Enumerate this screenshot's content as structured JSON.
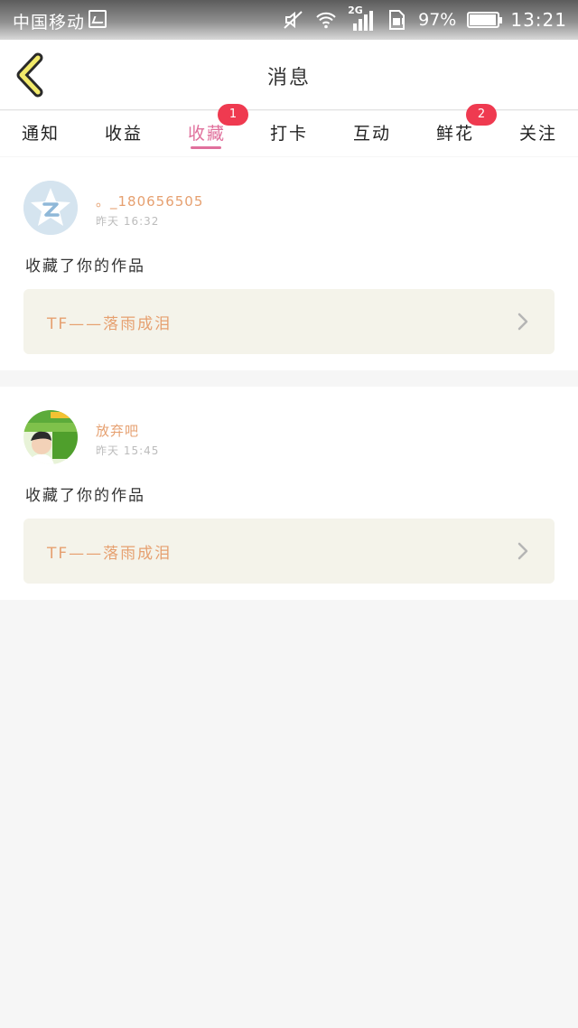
{
  "status_bar": {
    "carrier": "中国移动",
    "network": "2G",
    "battery_percent": "97%",
    "battery_level": 0.97,
    "time": "13:21"
  },
  "header": {
    "title": "消息"
  },
  "tabs": [
    {
      "label": "通知",
      "badge": ""
    },
    {
      "label": "收益",
      "badge": ""
    },
    {
      "label": "收藏",
      "badge": "1"
    },
    {
      "label": "打卡",
      "badge": ""
    },
    {
      "label": "互动",
      "badge": ""
    },
    {
      "label": "鲜花",
      "badge": "2"
    },
    {
      "label": "关注",
      "badge": ""
    }
  ],
  "active_tab": "收藏",
  "messages": [
    {
      "username": "。_180656505",
      "time": "昨天 16:32",
      "action": "收藏了你的作品",
      "work_title": "TF——落雨成泪",
      "avatar": "qq-default-avatar"
    },
    {
      "username": "放弃吧",
      "time": "昨天 15:45",
      "action": "收藏了你的作品",
      "work_title": "TF——落雨成泪",
      "avatar": "user-photo-avatar"
    }
  ],
  "colors": {
    "accent_pink": "#e0709c",
    "badge_red": "#ef3a50",
    "username_orange": "#e6a070",
    "back_arrow_yellow": "#f2ea6a"
  }
}
